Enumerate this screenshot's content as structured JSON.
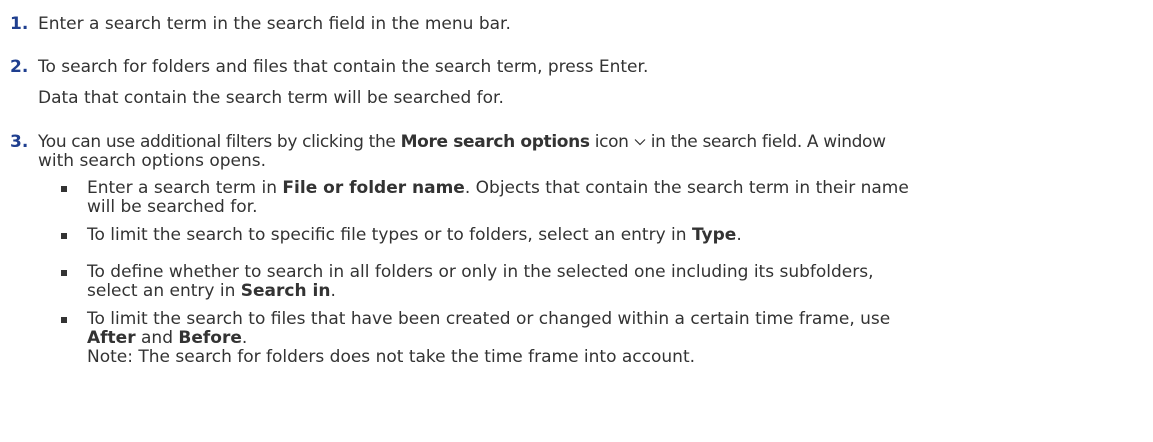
{
  "steps": [
    {
      "number": "1.",
      "text": "Enter a search term in the search field in the menu bar."
    },
    {
      "number": "2.",
      "text": "To search for folders and files that contain the search term, press Enter.",
      "result": "Data that contain the search term will be searched for."
    },
    {
      "number": "3.",
      "text_before": "You can use additional filters by clicking the",
      "bold": "More search options",
      "text_icon": "icon",
      "icon": "chevron-down-icon",
      "text_after": "in the search field. A window",
      "text_line2": "with search options opens.",
      "bullets": [
        {
          "before": "Enter a search term in",
          "bold": "File or folder name",
          "after": ". Objects that contain the search term in their name",
          "line2": "will be searched for."
        },
        {
          "before": "To limit the search to specific file types or to folders, select an entry in",
          "bold": "Type",
          "after": "."
        },
        {
          "before": "To define whether to search in all folders or only in the selected one including its subfolders,",
          "line2_before": "select an entry in",
          "bold": "Search in",
          "after": "."
        },
        {
          "before": "To limit the search to files that have been created or changed within a certain time frame, use",
          "bold1": "After",
          "mid": "and",
          "bold2": "Before",
          "after": ".",
          "note": "Note: The search for folders does not take the time frame into account."
        }
      ]
    }
  ]
}
